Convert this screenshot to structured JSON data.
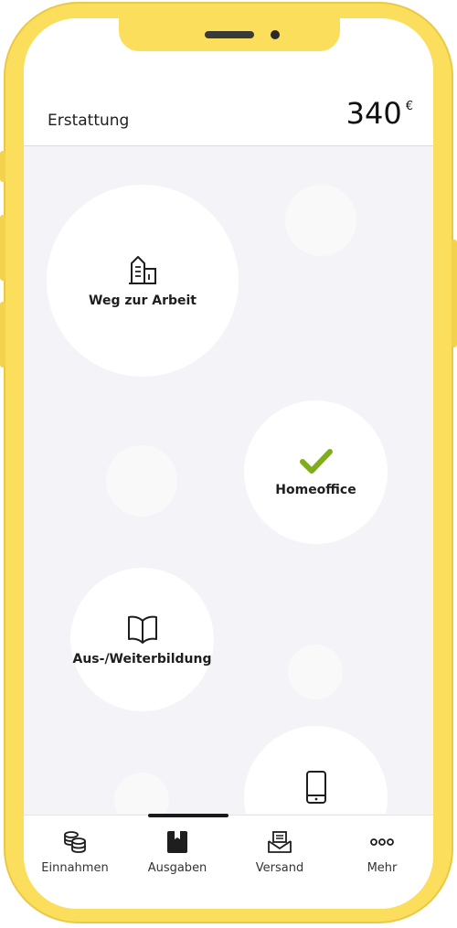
{
  "header": {
    "title": "Erstattung",
    "amount": "340",
    "currency": "€"
  },
  "categories": [
    {
      "label": "Weg zur Arbeit",
      "icon": "building-icon",
      "selected": false
    },
    {
      "label": "Homeoffice",
      "icon": "checkmark-icon",
      "selected": true
    },
    {
      "label": "Aus-/Weiterbildung",
      "icon": "book-icon",
      "selected": false
    },
    {
      "label": "",
      "icon": "smartphone-icon",
      "selected": false
    }
  ],
  "tabs": [
    {
      "label": "Einnahmen",
      "icon": "coins-icon"
    },
    {
      "label": "Ausgaben",
      "icon": "bookmark-book-icon",
      "active": true
    },
    {
      "label": "Versand",
      "icon": "envelope-icon"
    },
    {
      "label": "Mehr",
      "icon": "more-dots-icon"
    }
  ],
  "colors": {
    "frame": "#fbdf5c",
    "check": "#7fae1d",
    "background": "#f4f3f7"
  }
}
